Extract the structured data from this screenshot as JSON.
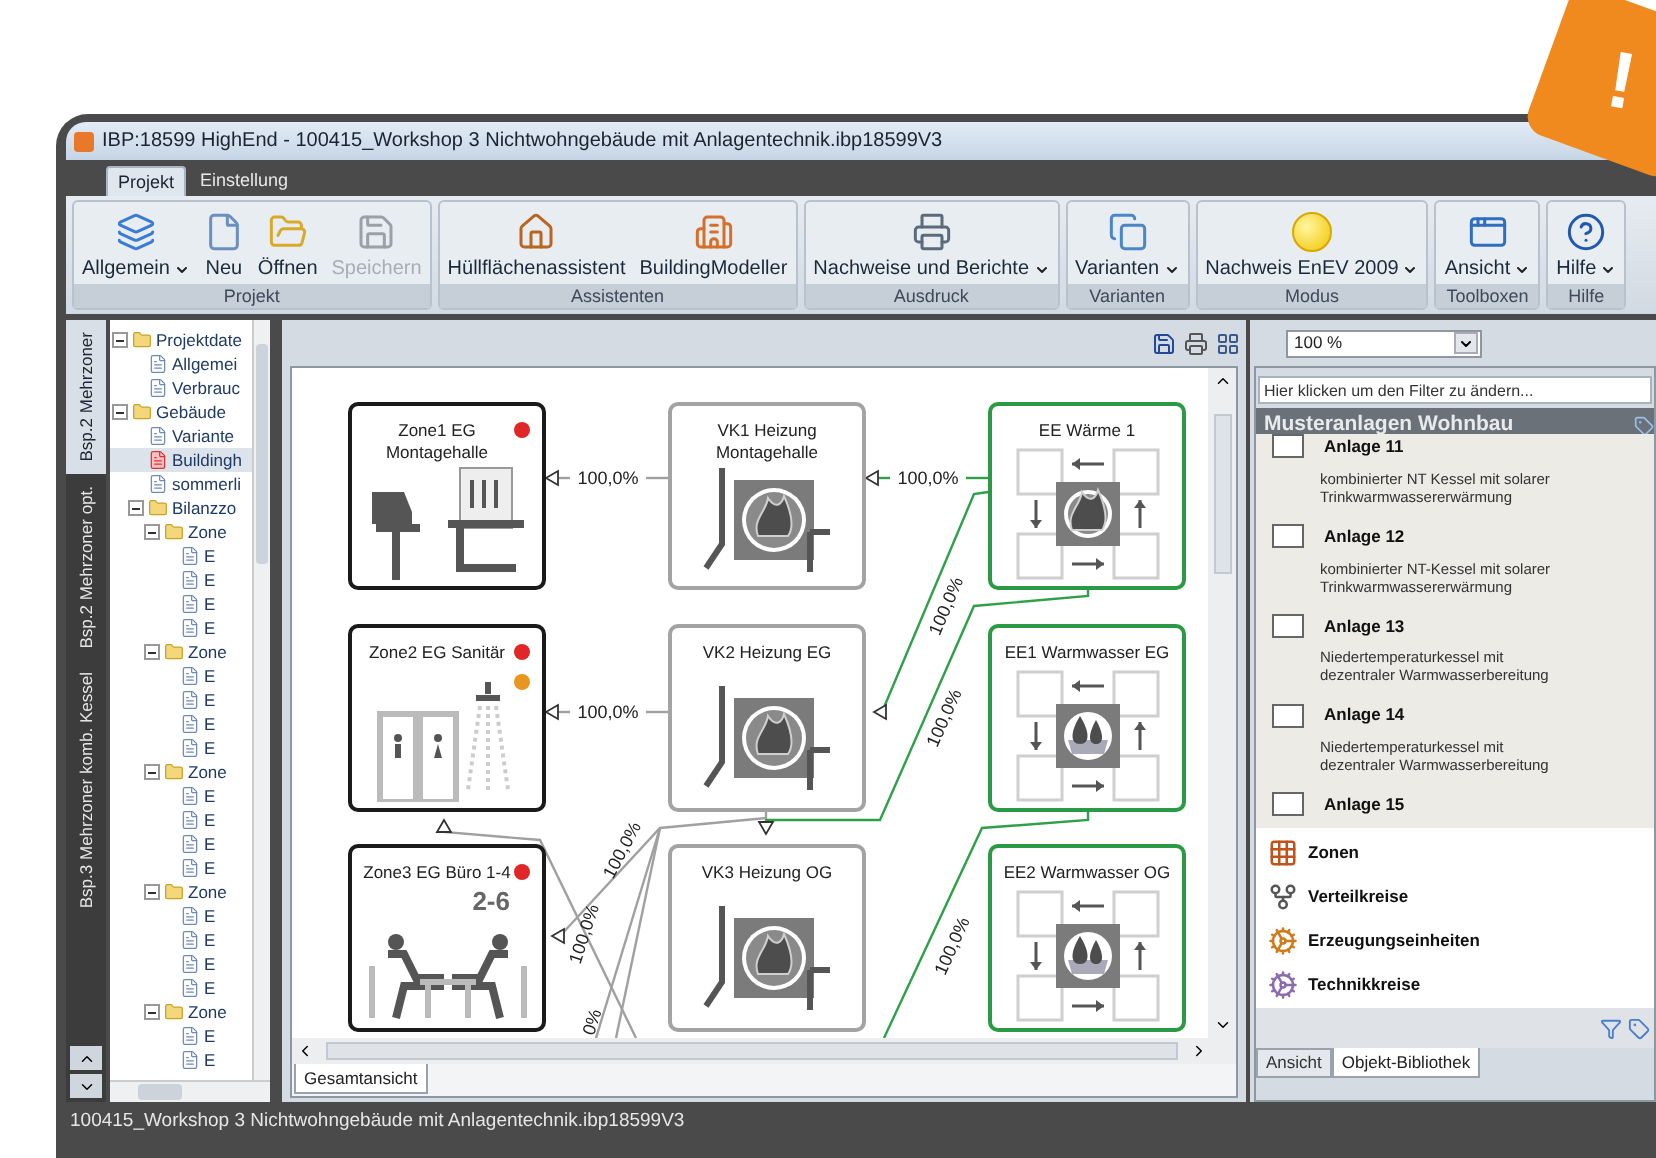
{
  "badge": {
    "text": "!"
  },
  "window": {
    "title": "IBP:18599 HighEnd - 100415_Workshop 3 Nichtwohngebäude mit Anlagentechnik.ibp18599V3"
  },
  "ribbon_tabs": [
    {
      "label": "Projekt",
      "selected": true
    },
    {
      "label": "Einstellung",
      "selected": false
    }
  ],
  "ribbon_groups": [
    {
      "label": "Projekt",
      "buttons": [
        {
          "label": "Allgemein",
          "dropdown": true,
          "disabled": false
        },
        {
          "label": "Neu",
          "dropdown": false,
          "disabled": false
        },
        {
          "label": "Öffnen",
          "dropdown": false,
          "disabled": false
        },
        {
          "label": "Speichern",
          "dropdown": false,
          "disabled": true
        }
      ]
    },
    {
      "label": "Assistenten",
      "buttons": [
        {
          "label": "Hüllflächenassistent",
          "dropdown": false,
          "disabled": false
        },
        {
          "label": "BuildingModeller",
          "dropdown": false,
          "disabled": false
        }
      ]
    },
    {
      "label": "Ausdruck",
      "buttons": [
        {
          "label": "Nachweise und Berichte",
          "dropdown": true,
          "disabled": false
        }
      ]
    },
    {
      "label": "Varianten",
      "buttons": [
        {
          "label": "Varianten",
          "dropdown": true,
          "disabled": false
        }
      ]
    },
    {
      "label": "Modus",
      "buttons": [
        {
          "label": "Nachweis EnEV 2009",
          "dropdown": true,
          "disabled": false
        }
      ]
    },
    {
      "label": "Toolboxen",
      "buttons": [
        {
          "label": "Ansicht",
          "dropdown": true,
          "disabled": false
        }
      ]
    },
    {
      "label": "Hilfe",
      "buttons": [
        {
          "label": "Hilfe",
          "dropdown": true,
          "disabled": false
        }
      ]
    }
  ],
  "side_tabs": [
    {
      "label": "Bsp.2 Mehrzoner",
      "selected": true
    },
    {
      "label": "Bsp.2 Mehrzoner opt.",
      "selected": false
    },
    {
      "label": "Bsp.3 Mehrzoner komb. Kessel",
      "selected": false
    }
  ],
  "tree": [
    {
      "label": "Projektdate",
      "kind": "folder",
      "selected": false,
      "expanded": true,
      "children": [
        {
          "label": "Allgemei",
          "kind": "document",
          "selected": false
        },
        {
          "label": "Verbrauc",
          "kind": "document",
          "selected": false
        }
      ]
    },
    {
      "label": "Gebäude",
      "kind": "folder",
      "selected": false,
      "expanded": true,
      "children": [
        {
          "label": "Variante",
          "kind": "document",
          "selected": false
        },
        {
          "label": "Buildingh",
          "kind": "model",
          "selected": true
        },
        {
          "label": "sommerli",
          "kind": "document",
          "selected": false
        },
        {
          "label": "Bilanzzo",
          "kind": "folder",
          "selected": false,
          "expanded": true,
          "children": [
            {
              "label": "Zone",
              "kind": "folder",
              "selected": false,
              "expanded": true,
              "children": [
                {
                  "label": "E",
                  "kind": "document",
                  "selected": false
                },
                {
                  "label": "E",
                  "kind": "document",
                  "selected": false
                },
                {
                  "label": "E",
                  "kind": "document",
                  "selected": false
                },
                {
                  "label": "E",
                  "kind": "document",
                  "selected": false
                }
              ]
            },
            {
              "label": "Zone",
              "kind": "folder",
              "selected": false,
              "expanded": true,
              "children": [
                {
                  "label": "E",
                  "kind": "document",
                  "selected": false
                },
                {
                  "label": "E",
                  "kind": "document",
                  "selected": false
                },
                {
                  "label": "E",
                  "kind": "document",
                  "selected": false
                },
                {
                  "label": "E",
                  "kind": "document",
                  "selected": false
                }
              ]
            },
            {
              "label": "Zone",
              "kind": "folder",
              "selected": false,
              "expanded": true,
              "children": [
                {
                  "label": "E",
                  "kind": "document",
                  "selected": false
                },
                {
                  "label": "E",
                  "kind": "document",
                  "selected": false
                },
                {
                  "label": "E",
                  "kind": "document",
                  "selected": false
                },
                {
                  "label": "E",
                  "kind": "document",
                  "selected": false
                }
              ]
            },
            {
              "label": "Zone",
              "kind": "folder",
              "selected": false,
              "expanded": true,
              "children": [
                {
                  "label": "E",
                  "kind": "document",
                  "selected": false
                },
                {
                  "label": "E",
                  "kind": "document",
                  "selected": false
                },
                {
                  "label": "E",
                  "kind": "document",
                  "selected": false
                },
                {
                  "label": "E",
                  "kind": "document",
                  "selected": false
                }
              ]
            },
            {
              "label": "Zone",
              "kind": "folder",
              "selected": false,
              "expanded": true,
              "children": [
                {
                  "label": "E",
                  "kind": "document",
                  "selected": false
                },
                {
                  "label": "E",
                  "kind": "document",
                  "selected": false
                }
              ]
            }
          ]
        }
      ]
    }
  ],
  "diagram": {
    "nodes": [
      {
        "kind": "zone",
        "title": "Zone1 EG Montagehalle",
        "dots": [
          {
            "color": "#e02626"
          }
        ]
      },
      {
        "kind": "distribution",
        "title": "VK1 Heizung Montagehalle"
      },
      {
        "kind": "heater",
        "title": "EE Wärme 1"
      },
      {
        "kind": "zone",
        "title": "Zone2 EG Sanitär",
        "dots": [
          {
            "color": "#e02626"
          },
          {
            "color": "#e8961e"
          }
        ]
      },
      {
        "kind": "distribution",
        "title": "VK2 Heizung EG"
      },
      {
        "kind": "waterheater",
        "title": "EE1 Warmwasser EG"
      },
      {
        "kind": "zone",
        "title": "Zone3 EG Büro 1-4",
        "subtitle": "2-6",
        "dots": [
          {
            "color": "#e02626"
          }
        ]
      },
      {
        "kind": "distribution",
        "title": "VK3 Heizung OG"
      },
      {
        "kind": "waterheater",
        "title": "EE2 Warmwasser OG"
      }
    ],
    "edges": [
      {
        "label": "100,0%",
        "color": "#a0a0a0"
      },
      {
        "label": "100,0%",
        "color": "#2fa04a"
      },
      {
        "label": "100,0%",
        "color": "#2fa04a"
      },
      {
        "label": "100,0%",
        "color": "#2fa04a"
      },
      {
        "label": "100,0%",
        "color": "#a0a0a0"
      },
      {
        "label": "100,0%",
        "color": "#a0a0a0"
      },
      {
        "label": "100,0%",
        "color": "#a0a0a0"
      },
      {
        "label": "100,0%",
        "color": "#2fa04a"
      },
      {
        "label": "0%",
        "color": "#a0a0a0"
      }
    ]
  },
  "canvas_tabs": [
    {
      "label": "Gesamtansicht",
      "selected": true
    }
  ],
  "zoom_select": {
    "value": "100 %"
  },
  "filter": {
    "placeholder": "Hier klicken um den Filter zu ändern..."
  },
  "library": {
    "title": "Musteranlagen Wohnbau",
    "items": [
      {
        "title": "Anlage 11",
        "description": "kombinierter NT Kessel mit solarer Trinkwarmwassererwärmung"
      },
      {
        "title": "Anlage 12",
        "description": "kombinierter NT-Kessel mit solarer Trinkwarmwassererwärmung"
      },
      {
        "title": "Anlage 13",
        "description": "Niedertemperaturkessel mit dezentraler Warmwasserbereitung"
      },
      {
        "title": "Anlage 14",
        "description": "Niedertemperaturkessel mit dezentraler Warmwasserbereitung"
      },
      {
        "title": "Anlage 15"
      }
    ]
  },
  "categories": [
    {
      "label": "Zonen"
    },
    {
      "label": "Verteilkreise"
    },
    {
      "label": "Erzeugungseinheiten"
    },
    {
      "label": "Technikkreise"
    }
  ],
  "panel_tabs": [
    {
      "label": "Ansicht",
      "selected": false
    },
    {
      "label": "Objekt-Bibliothek",
      "selected": true
    }
  ],
  "status_bar": {
    "text": "100415_Workshop 3 Nichtwohngebäude mit Anlagentechnik.ibp18599V3"
  }
}
